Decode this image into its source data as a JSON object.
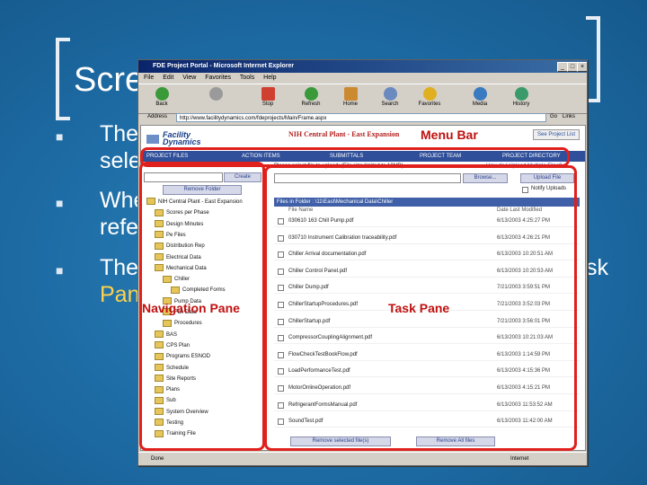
{
  "slide": {
    "title": "Scre",
    "bullets": [
      {
        "line1": "The",
        "line2": "sele"
      },
      {
        "line1": "Whe",
        "line2": "refe"
      },
      {
        "line1": "The",
        "line1_tail": "sk",
        "line2": "Pan"
      }
    ]
  },
  "browser": {
    "window_title": "FDE Project Portal - Microsoft Internet Explorer",
    "menu": [
      "File",
      "Edit",
      "View",
      "Favorites",
      "Tools",
      "Help"
    ],
    "toolbar": [
      {
        "label": "Back",
        "icon": "back-icon",
        "color": "#3a9a3a"
      },
      {
        "label": "",
        "icon": "forward-icon",
        "color": "#9a9a9a"
      },
      {
        "label": "Stop",
        "icon": "stop-icon",
        "color": "#d04030"
      },
      {
        "label": "Refresh",
        "icon": "refresh-icon",
        "color": "#3a9a3a"
      },
      {
        "label": "Home",
        "icon": "home-icon",
        "color": "#cc8a30"
      },
      {
        "label": "Search",
        "icon": "search-icon",
        "color": "#6a8ac0"
      },
      {
        "label": "Favorites",
        "icon": "favorites-icon",
        "color": "#e0b020"
      },
      {
        "label": "Media",
        "icon": "media-icon",
        "color": "#3a7ac0"
      },
      {
        "label": "History",
        "icon": "history-icon",
        "color": "#3a9a6a"
      }
    ],
    "address_label": "Address",
    "address_url": "http://www.facilitydynamics.com/fdeprojects/Main/Frame.aspx",
    "go_label": "Go",
    "links_label": "Links",
    "status_text": "Done",
    "status_zone": "Internet"
  },
  "site": {
    "logo_line1": "Facility",
    "logo_line2": "Dynamics",
    "title": "NIH Central Plant - East Expansion",
    "see_projects": "See Project List",
    "nav": [
      "PROJECT FILES",
      "ACTION ITEMS",
      "SUBMITTALS",
      "PROJECT TEAM",
      "PROJECT DIRECTORY"
    ],
    "new_folder_label": "New Folder name:",
    "create_label": "Create",
    "remove_folder_label": "Remove Folder",
    "upload_label": "Please select file to upload: (File size limited to 10MB)",
    "upload_multi": "How do I Upload Multiple Files?",
    "browse_label": "Browse...",
    "upload_btn": "Upload File",
    "notify_label": "Notify Uploads",
    "files_header": "Files in Folder : \\11\\East\\Mechanical Data\\Chiller",
    "col_name": "File Name",
    "col_date": "Date Last Modified",
    "remove_selected": "Remove selected file(s)",
    "remove_all": "Remove All files"
  },
  "tree": [
    {
      "label": "NIH Central Plant - East Expansion",
      "indent": 0
    },
    {
      "label": "Scores per Phase",
      "indent": 1
    },
    {
      "label": "Design Minutes",
      "indent": 1
    },
    {
      "label": "Pe Files",
      "indent": 1
    },
    {
      "label": "Distribution Rep",
      "indent": 1
    },
    {
      "label": "Electrical Data",
      "indent": 1
    },
    {
      "label": "Mechanical Data",
      "indent": 1
    },
    {
      "label": "Chiller",
      "indent": 2
    },
    {
      "label": "Completed Forms",
      "indent": 3
    },
    {
      "label": "Pump Data",
      "indent": 2
    },
    {
      "label": "Fan Data",
      "indent": 2
    },
    {
      "label": "Procedures",
      "indent": 2
    },
    {
      "label": "BAS",
      "indent": 1
    },
    {
      "label": "CPS Plan",
      "indent": 1
    },
    {
      "label": "Programs ESNOD",
      "indent": 1
    },
    {
      "label": "Schedule",
      "indent": 1
    },
    {
      "label": "Site Reports",
      "indent": 1
    },
    {
      "label": "Plans",
      "indent": 1
    },
    {
      "label": "Sub",
      "indent": 1
    },
    {
      "label": "System Overview",
      "indent": 1
    },
    {
      "label": "Testing",
      "indent": 1
    },
    {
      "label": "Training File",
      "indent": 1
    }
  ],
  "files": [
    {
      "name": "030610 163 Chill Pump.pdf",
      "date": "6/13/2003 4:25:27 PM"
    },
    {
      "name": "030710 Instrument Calibration traceability.pdf",
      "date": "6/13/2003 4:26:21 PM"
    },
    {
      "name": "Chiller Arrival documentation.pdf",
      "date": "6/13/2003 10:20:51 AM"
    },
    {
      "name": "Chiller Control Panel.pdf",
      "date": "6/13/2003 10:20:53 AM"
    },
    {
      "name": "Chiller Dump.pdf",
      "date": "7/21/2003 3:59:51 PM"
    },
    {
      "name": "ChillerStartupProcedures.pdf",
      "date": "7/21/2003 3:52:03 PM"
    },
    {
      "name": "ChillerStartup.pdf",
      "date": "7/21/2003 3:56:01 PM"
    },
    {
      "name": "CompressorCouplingAlignment.pdf",
      "date": "6/13/2003 10:21:03 AM"
    },
    {
      "name": "FlowCheckTestBookFlow.pdf",
      "date": "6/13/2003 1:14:59 PM"
    },
    {
      "name": "LoadPerformanceTest.pdf",
      "date": "6/13/2003 4:15:36 PM"
    },
    {
      "name": "MotorOnlineOperation.pdf",
      "date": "6/13/2003 4:15:21 PM"
    },
    {
      "name": "RefrigerantFormsManual.pdf",
      "date": "6/13/2003 11:53:52 AM"
    },
    {
      "name": "SoundTest.pdf",
      "date": "6/13/2003 11:42:00 AM"
    }
  ],
  "annotations": {
    "menu_bar": "Menu Bar",
    "navigation_pane": "Navigation Pane",
    "task_pane": "Task Pane",
    "color": "#e0201c"
  }
}
